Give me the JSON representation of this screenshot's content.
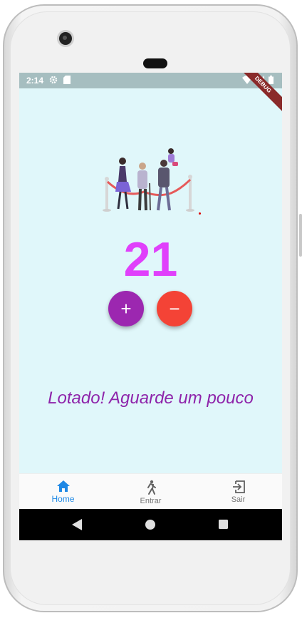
{
  "status_bar": {
    "time": "2:14",
    "debug_banner": "DEBUG"
  },
  "counter": {
    "value": "21",
    "color": "#e040fb"
  },
  "buttons": {
    "increment_symbol": "+",
    "decrement_symbol": "−"
  },
  "message": {
    "text": "Lotado! Aguarde um pouco"
  },
  "bottom_nav": {
    "items": [
      {
        "label": "Home",
        "icon": "home-icon",
        "active": true
      },
      {
        "label": "Entrar",
        "icon": "walk-icon",
        "active": false
      },
      {
        "label": "Sair",
        "icon": "exit-icon",
        "active": false
      }
    ]
  },
  "colors": {
    "background": "#e0f7fa",
    "plus_button": "#9c27b0",
    "minus_button": "#f44336",
    "message": "#8e24aa",
    "nav_active": "#1e88e5"
  }
}
